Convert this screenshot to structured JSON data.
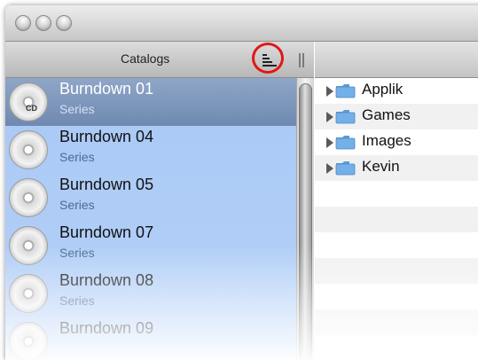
{
  "sidebar": {
    "title": "Catalogs",
    "items": [
      {
        "name": "Burndown 01",
        "subtitle": "Series",
        "selected": true
      },
      {
        "name": "Burndown 04",
        "subtitle": "Series",
        "selected": false
      },
      {
        "name": "Burndown 05",
        "subtitle": "Series",
        "selected": false
      },
      {
        "name": "Burndown 07",
        "subtitle": "Series",
        "selected": false
      },
      {
        "name": "Burndown 08",
        "subtitle": "Series",
        "selected": false
      },
      {
        "name": "Burndown 09",
        "subtitle": "",
        "selected": false
      }
    ]
  },
  "disc_label": "CD",
  "folders": [
    {
      "name": "Applik"
    },
    {
      "name": "Games"
    },
    {
      "name": "Images"
    },
    {
      "name": "Kevin"
    }
  ],
  "colors": {
    "selection": "#7f98bf",
    "list_background": "#aecbf6",
    "folder_icon": "#74b0e8",
    "annotation_circle": "#e01818"
  },
  "icons": {
    "window_controls": [
      "close-icon",
      "minimize-icon",
      "zoom-icon"
    ],
    "sort": "sort-icon",
    "column_resize": "column-resize-icon",
    "folder": "folder-icon",
    "disclosure": "disclosure-triangle-icon"
  }
}
